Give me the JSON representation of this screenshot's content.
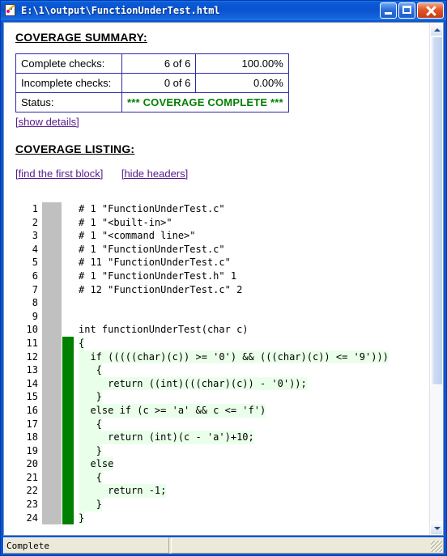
{
  "window": {
    "title": "E:\\1\\output\\FunctionUnderTest.html",
    "icon": "document-pen-icon",
    "buttons": {
      "minimize": "Minimize",
      "maximize": "Maximize",
      "close": "Close"
    }
  },
  "statusbar": {
    "left_text": "Complete",
    "right_text": ""
  },
  "scrollbar": {
    "up_label": "Scroll up",
    "down_label": "Scroll down"
  },
  "document": {
    "summary_heading": "COVERAGE SUMMARY:",
    "summary_table": {
      "rows": [
        {
          "label": "Complete checks:",
          "count": "6 of 6",
          "percent": "100.00%"
        },
        {
          "label": "Incomplete checks:",
          "count": "0 of 6",
          "percent": "0.00%"
        }
      ],
      "status_label": "Status:",
      "status_value": "*** COVERAGE COMPLETE ***"
    },
    "show_details_link": "[show details]",
    "listing_heading": "COVERAGE LISTING:",
    "find_first_block_link": "[find the first block]",
    "hide_headers_link": "[hide headers]",
    "code_lines": [
      {
        "n": "1",
        "grey": true,
        "green": false,
        "covered": false,
        "text": "# 1 \"FunctionUnderTest.c\""
      },
      {
        "n": "2",
        "grey": true,
        "green": false,
        "covered": false,
        "text": "# 1 \"<built-in>\""
      },
      {
        "n": "3",
        "grey": true,
        "green": false,
        "covered": false,
        "text": "# 1 \"<command line>\""
      },
      {
        "n": "4",
        "grey": true,
        "green": false,
        "covered": false,
        "text": "# 1 \"FunctionUnderTest.c\""
      },
      {
        "n": "5",
        "grey": true,
        "green": false,
        "covered": false,
        "text": "# 11 \"FunctionUnderTest.c\""
      },
      {
        "n": "6",
        "grey": true,
        "green": false,
        "covered": false,
        "text": "# 1 \"FunctionUnderTest.h\" 1"
      },
      {
        "n": "7",
        "grey": true,
        "green": false,
        "covered": false,
        "text": "# 12 \"FunctionUnderTest.c\" 2"
      },
      {
        "n": "8",
        "grey": true,
        "green": false,
        "covered": false,
        "text": ""
      },
      {
        "n": "9",
        "grey": true,
        "green": false,
        "covered": false,
        "text": ""
      },
      {
        "n": "10",
        "grey": true,
        "green": false,
        "covered": false,
        "text": "int functionUnderTest(char c)"
      },
      {
        "n": "11",
        "grey": true,
        "green": true,
        "covered": true,
        "text": "{"
      },
      {
        "n": "12",
        "grey": true,
        "green": true,
        "covered": true,
        "text": "  if (((((char)(c)) >= '0') && (((char)(c)) <= '9')))"
      },
      {
        "n": "13",
        "grey": true,
        "green": true,
        "covered": true,
        "text": "   {"
      },
      {
        "n": "14",
        "grey": true,
        "green": true,
        "covered": true,
        "text": "     return ((int)(((char)(c)) - '0'));"
      },
      {
        "n": "15",
        "grey": true,
        "green": true,
        "covered": true,
        "text": "   }"
      },
      {
        "n": "16",
        "grey": true,
        "green": true,
        "covered": true,
        "text": "  else if (c >= 'a' && c <= 'f')"
      },
      {
        "n": "17",
        "grey": true,
        "green": true,
        "covered": true,
        "text": "   {"
      },
      {
        "n": "18",
        "grey": true,
        "green": true,
        "covered": true,
        "text": "     return (int)(c - 'a')+10;"
      },
      {
        "n": "19",
        "grey": true,
        "green": true,
        "covered": true,
        "text": "   }"
      },
      {
        "n": "20",
        "grey": true,
        "green": true,
        "covered": true,
        "text": "  else"
      },
      {
        "n": "21",
        "grey": true,
        "green": true,
        "covered": true,
        "text": "   {"
      },
      {
        "n": "22",
        "grey": true,
        "green": true,
        "covered": true,
        "text": "     return -1;"
      },
      {
        "n": "23",
        "grey": true,
        "green": true,
        "covered": true,
        "text": "   }"
      },
      {
        "n": "24",
        "grey": true,
        "green": true,
        "covered": true,
        "text": "}"
      }
    ]
  },
  "colors": {
    "titlebar_blue": "#0a52cf",
    "marker_covered": "#008000",
    "marker_uncovered": "#c0c0c0",
    "code_covered_bg": "#eaffea",
    "status_complete": "#008000",
    "link": "#551a8b",
    "table_border": "#2a2aa8",
    "statusbar_bg": "#ece9d8"
  }
}
